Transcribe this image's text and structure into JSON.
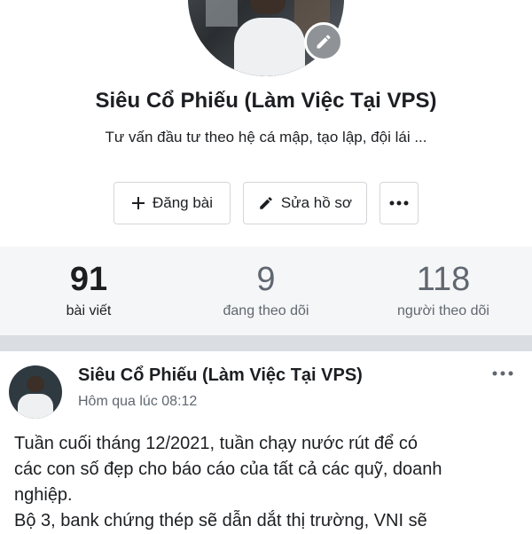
{
  "profile": {
    "name": "Siêu Cổ Phiếu (Làm Việc Tại VPS)",
    "bio": "Tư vấn đầu tư theo hệ cá mập, tạo lập, đội lái ..."
  },
  "actions": {
    "add_post": "Đăng bài",
    "edit_profile": "Sửa hồ sơ"
  },
  "stats": [
    {
      "value": "91",
      "label": "bài viết"
    },
    {
      "value": "9",
      "label": "đang theo dõi"
    },
    {
      "value": "118",
      "label": "người theo dõi"
    }
  ],
  "post": {
    "author": "Siêu Cổ Phiếu (Làm Việc Tại VPS)",
    "time": "Hôm qua lúc 08:12",
    "text": "Tuần cuối tháng 12/2021, tuần chạy nước rút để có\ncác con số đẹp cho báo cáo của tất cả các quỹ, doanh\nnghiệp.\nBộ 3, bank chứng thép sẽ dẫn dắt thị trường, VNI sẽ"
  },
  "colors": {
    "text": "#1c1e21",
    "secondary": "#606770",
    "stats_bg": "#f5f6f7",
    "divider": "#dadde1"
  }
}
